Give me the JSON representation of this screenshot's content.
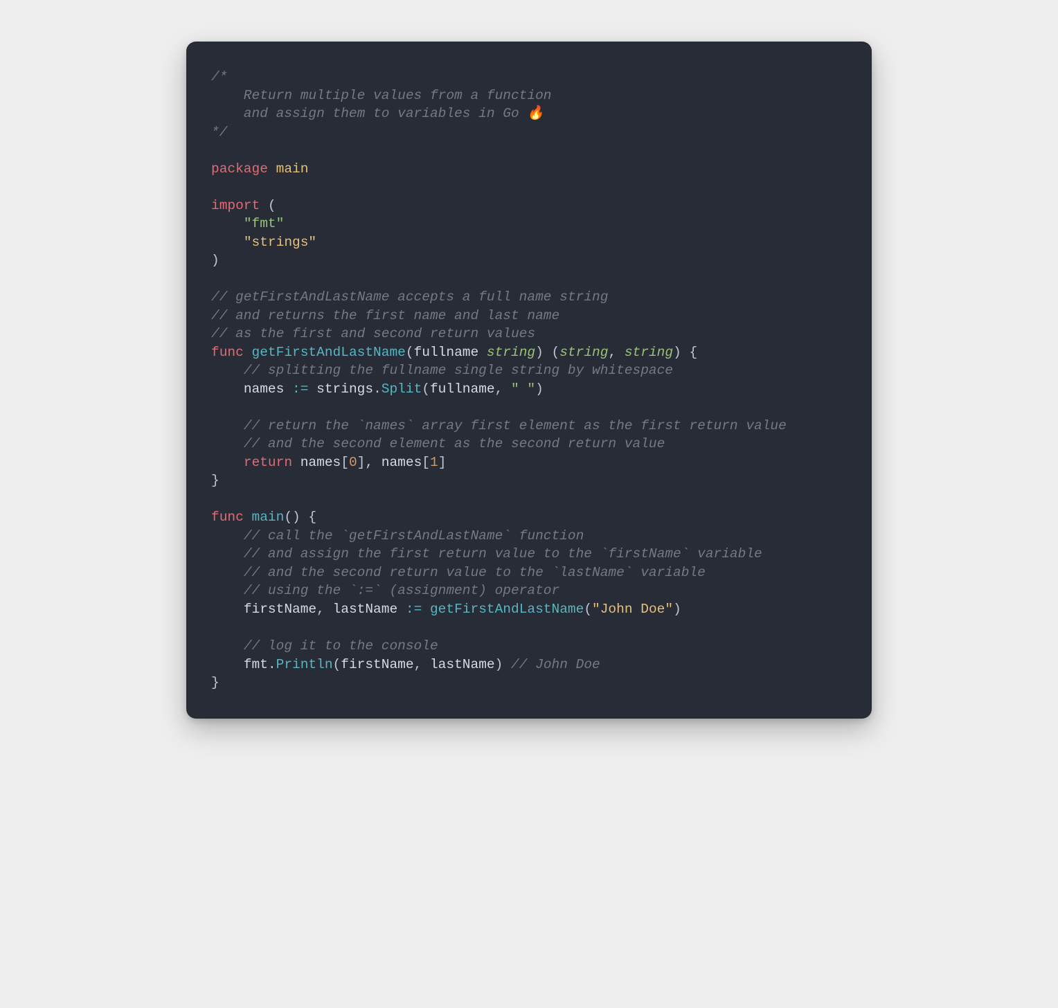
{
  "colors": {
    "comment": "#727a87",
    "commentItalic": "#727a87",
    "keywordRed": "#e06c75",
    "ident": "#e5c07b",
    "punct": "#bfc7d5",
    "string": "#98c379",
    "funcName": "#56b6c2",
    "typeGreen": "#98c379",
    "opTeal": "#56b6c2",
    "num": "#d19a66",
    "default": "#d7dae0"
  },
  "tokens": [
    [
      {
        "t": "/*",
        "c": "commentItalic",
        "i": true
      }
    ],
    [
      {
        "t": "    Return multiple values from a function",
        "c": "commentItalic",
        "i": true
      }
    ],
    [
      {
        "t": "    and assign them to variables in Go 🔥",
        "c": "commentItalic",
        "i": true
      }
    ],
    [
      {
        "t": "*/",
        "c": "commentItalic",
        "i": true
      }
    ],
    [],
    [
      {
        "t": "package",
        "c": "keywordRed"
      },
      {
        "t": " ",
        "c": "default"
      },
      {
        "t": "main",
        "c": "ident"
      }
    ],
    [],
    [
      {
        "t": "import",
        "c": "keywordRed"
      },
      {
        "t": " (",
        "c": "punct"
      }
    ],
    [
      {
        "t": "    ",
        "c": "default"
      },
      {
        "t": "\"fmt\"",
        "c": "string"
      }
    ],
    [
      {
        "t": "    ",
        "c": "default"
      },
      {
        "t": "\"strings\"",
        "c": "ident"
      }
    ],
    [
      {
        "t": ")",
        "c": "punct"
      }
    ],
    [],
    [
      {
        "t": "// getFirstAndLastName accepts a full name string",
        "c": "commentItalic",
        "i": true
      }
    ],
    [
      {
        "t": "// and returns the first name and last name",
        "c": "commentItalic",
        "i": true
      }
    ],
    [
      {
        "t": "// as the first and second return values",
        "c": "commentItalic",
        "i": true
      }
    ],
    [
      {
        "t": "func",
        "c": "keywordRed"
      },
      {
        "t": " ",
        "c": "default"
      },
      {
        "t": "getFirstAndLastName",
        "c": "funcName"
      },
      {
        "t": "(",
        "c": "punct"
      },
      {
        "t": "fullname",
        "c": "default"
      },
      {
        "t": " ",
        "c": "default"
      },
      {
        "t": "string",
        "c": "typeGreen",
        "i": true
      },
      {
        "t": ")",
        "c": "punct"
      },
      {
        "t": " (",
        "c": "punct"
      },
      {
        "t": "string",
        "c": "typeGreen",
        "i": true
      },
      {
        "t": ",",
        "c": "punct"
      },
      {
        "t": " ",
        "c": "default"
      },
      {
        "t": "string",
        "c": "typeGreen",
        "i": true
      },
      {
        "t": ")",
        "c": "punct"
      },
      {
        "t": " {",
        "c": "punct"
      }
    ],
    [
      {
        "t": "    ",
        "c": "default"
      },
      {
        "t": "// splitting the fullname single string by whitespace",
        "c": "commentItalic",
        "i": true
      }
    ],
    [
      {
        "t": "    ",
        "c": "default"
      },
      {
        "t": "names",
        "c": "default"
      },
      {
        "t": " ",
        "c": "default"
      },
      {
        "t": ":=",
        "c": "opTeal"
      },
      {
        "t": " ",
        "c": "default"
      },
      {
        "t": "strings",
        "c": "default"
      },
      {
        "t": ".",
        "c": "punct"
      },
      {
        "t": "Split",
        "c": "funcName"
      },
      {
        "t": "(",
        "c": "punct"
      },
      {
        "t": "fullname",
        "c": "default"
      },
      {
        "t": ",",
        "c": "punct"
      },
      {
        "t": " ",
        "c": "default"
      },
      {
        "t": "\" \"",
        "c": "string"
      },
      {
        "t": ")",
        "c": "punct"
      }
    ],
    [],
    [
      {
        "t": "    ",
        "c": "default"
      },
      {
        "t": "// return the `names` array first element as the first return value",
        "c": "commentItalic",
        "i": true
      }
    ],
    [
      {
        "t": "    ",
        "c": "default"
      },
      {
        "t": "// and the second element as the second return value",
        "c": "commentItalic",
        "i": true
      }
    ],
    [
      {
        "t": "    ",
        "c": "default"
      },
      {
        "t": "return",
        "c": "keywordRed"
      },
      {
        "t": " ",
        "c": "default"
      },
      {
        "t": "names",
        "c": "default"
      },
      {
        "t": "[",
        "c": "punct"
      },
      {
        "t": "0",
        "c": "num"
      },
      {
        "t": "]",
        "c": "punct"
      },
      {
        "t": ",",
        "c": "punct"
      },
      {
        "t": " ",
        "c": "default"
      },
      {
        "t": "names",
        "c": "default"
      },
      {
        "t": "[",
        "c": "punct"
      },
      {
        "t": "1",
        "c": "num"
      },
      {
        "t": "]",
        "c": "punct"
      }
    ],
    [
      {
        "t": "}",
        "c": "punct"
      }
    ],
    [],
    [
      {
        "t": "func",
        "c": "keywordRed"
      },
      {
        "t": " ",
        "c": "default"
      },
      {
        "t": "main",
        "c": "funcName"
      },
      {
        "t": "()",
        "c": "punct"
      },
      {
        "t": " {",
        "c": "punct"
      }
    ],
    [
      {
        "t": "    ",
        "c": "default"
      },
      {
        "t": "// call the `getFirstAndLastName` function",
        "c": "commentItalic",
        "i": true
      }
    ],
    [
      {
        "t": "    ",
        "c": "default"
      },
      {
        "t": "// and assign the first return value to the `firstName` variable",
        "c": "commentItalic",
        "i": true
      }
    ],
    [
      {
        "t": "    ",
        "c": "default"
      },
      {
        "t": "// and the second return value to the `lastName` variable",
        "c": "commentItalic",
        "i": true
      }
    ],
    [
      {
        "t": "    ",
        "c": "default"
      },
      {
        "t": "// using the `:=` (assignment) operator",
        "c": "commentItalic",
        "i": true
      }
    ],
    [
      {
        "t": "    ",
        "c": "default"
      },
      {
        "t": "firstName",
        "c": "default"
      },
      {
        "t": ",",
        "c": "punct"
      },
      {
        "t": " ",
        "c": "default"
      },
      {
        "t": "lastName",
        "c": "default"
      },
      {
        "t": " ",
        "c": "default"
      },
      {
        "t": ":=",
        "c": "opTeal"
      },
      {
        "t": " ",
        "c": "default"
      },
      {
        "t": "getFirstAndLastName",
        "c": "funcName"
      },
      {
        "t": "(",
        "c": "punct"
      },
      {
        "t": "\"John Doe\"",
        "c": "ident"
      },
      {
        "t": ")",
        "c": "punct"
      }
    ],
    [],
    [
      {
        "t": "    ",
        "c": "default"
      },
      {
        "t": "// log it to the console",
        "c": "commentItalic",
        "i": true
      }
    ],
    [
      {
        "t": "    ",
        "c": "default"
      },
      {
        "t": "fmt",
        "c": "default"
      },
      {
        "t": ".",
        "c": "punct"
      },
      {
        "t": "Println",
        "c": "funcName"
      },
      {
        "t": "(",
        "c": "punct"
      },
      {
        "t": "firstName",
        "c": "default"
      },
      {
        "t": ",",
        "c": "punct"
      },
      {
        "t": " ",
        "c": "default"
      },
      {
        "t": "lastName",
        "c": "default"
      },
      {
        "t": ")",
        "c": "punct"
      },
      {
        "t": " ",
        "c": "default"
      },
      {
        "t": "// John Doe",
        "c": "commentItalic",
        "i": true
      }
    ],
    [
      {
        "t": "}",
        "c": "punct"
      }
    ]
  ]
}
